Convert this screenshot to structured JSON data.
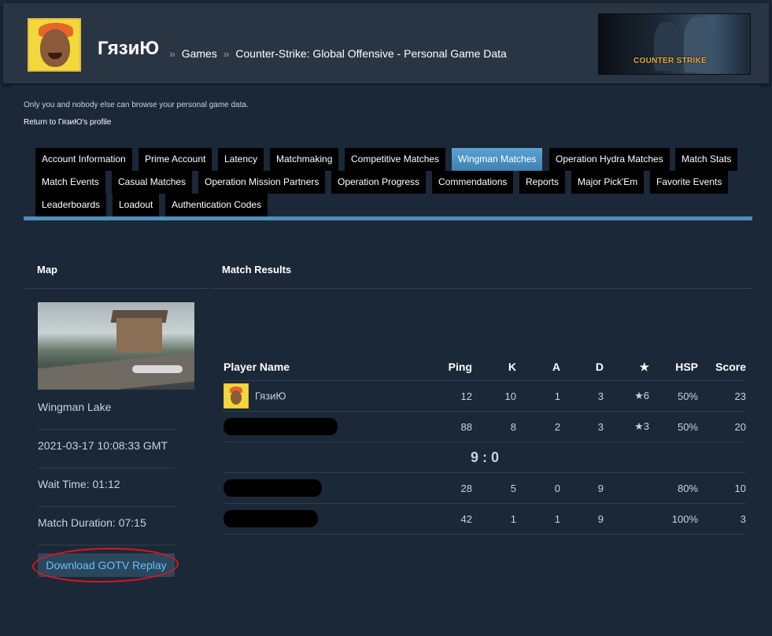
{
  "header": {
    "profile_name": "ГязиЮ",
    "breadcrumb_sep": "»",
    "crumb_games": "Games",
    "crumb_page": "Counter-Strike: Global Offensive - Personal Game Data",
    "banner_text": "COUNTER STRIKE"
  },
  "notice": "Only you and nobody else can browse your personal game data.",
  "return_link": "Return to ГязиЮ's profile",
  "tabs_row1": [
    "Account Information",
    "Prime Account",
    "Latency",
    "Matchmaking",
    "Competitive Matches",
    "Wingman Matches",
    "Operation Hydra Matches",
    "Match Stats"
  ],
  "tabs_row2": [
    "Match Events",
    "Casual Matches",
    "Operation Mission Partners",
    "Operation Progress",
    "Commendations",
    "Reports",
    "Major Pick'Em",
    "Favorite Events"
  ],
  "tabs_row3": [
    "Leaderboards",
    "Loadout",
    "Authentication Codes"
  ],
  "active_tab": "Wingman Matches",
  "map_panel": {
    "heading": "Map",
    "map_name": "Wingman Lake",
    "date": "2021-03-17 10:08:33 GMT",
    "wait_time": "Wait Time: 01:12",
    "duration": "Match Duration: 07:15",
    "download_label": "Download GOTV Replay"
  },
  "results": {
    "heading": "Match Results",
    "columns": [
      "Player Name",
      "Ping",
      "K",
      "A",
      "D",
      "★",
      "HSP",
      "Score"
    ],
    "team1": [
      {
        "name": "ГязиЮ",
        "ping": "12",
        "k": "10",
        "a": "1",
        "d": "3",
        "mvp": "★6",
        "hsp": "50%",
        "score": "23"
      },
      {
        "name": "",
        "ping": "88",
        "k": "8",
        "a": "2",
        "d": "3",
        "mvp": "★3",
        "hsp": "50%",
        "score": "20"
      }
    ],
    "scoreline": "9 : 0",
    "team2": [
      {
        "name": "",
        "ping": "28",
        "k": "5",
        "a": "0",
        "d": "9",
        "mvp": "",
        "hsp": "80%",
        "score": "10"
      },
      {
        "name": "",
        "ping": "42",
        "k": "1",
        "a": "1",
        "d": "9",
        "mvp": "",
        "hsp": "100%",
        "score": "3"
      }
    ]
  }
}
